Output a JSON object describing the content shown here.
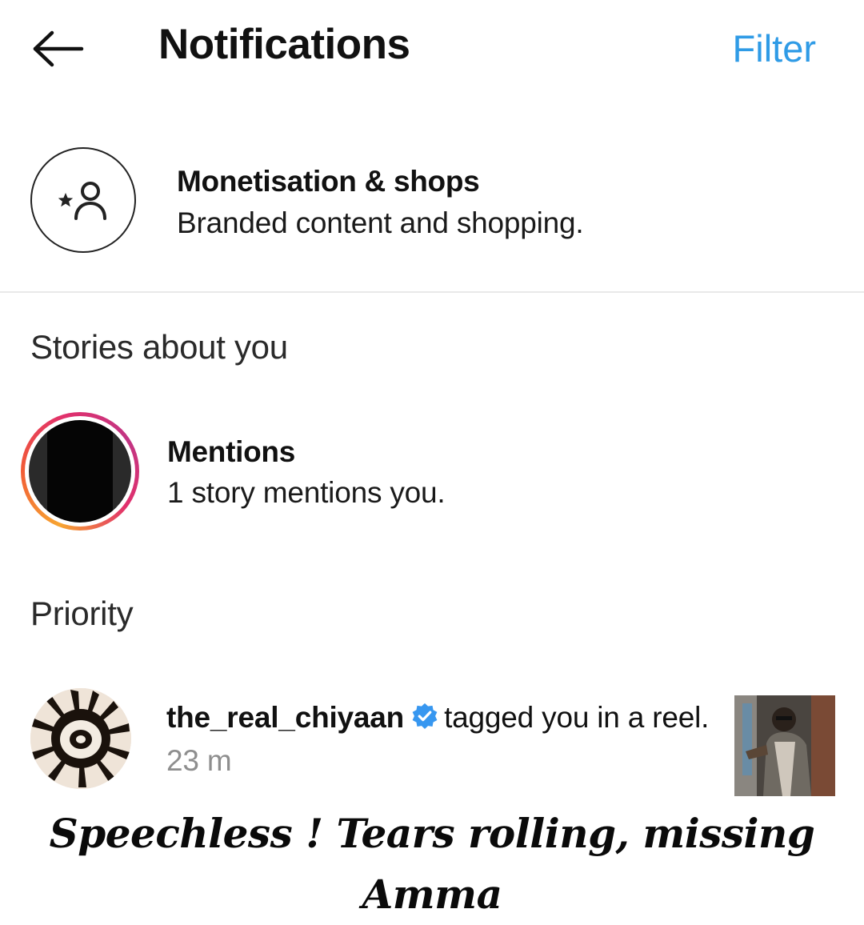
{
  "header": {
    "back_icon": "arrow-left-icon",
    "title": "Notifications",
    "filter_label": "Filter",
    "accent_color": "#2f9be6"
  },
  "monetisation": {
    "icon": "person-star-icon",
    "title": "Monetisation & shops",
    "subtitle": "Branded content and shopping."
  },
  "stories_section": {
    "header": "Stories about you",
    "mentions": {
      "title": "Mentions",
      "subtitle": "1 story mentions you."
    }
  },
  "priority_section": {
    "header": "Priority",
    "notification": {
      "username": "the_real_chiyaan",
      "verified_icon": "verified-badge-icon",
      "action_text": "tagged you in a reel.",
      "timestamp": "23 m"
    }
  },
  "caption": "Speechless ! Tears rolling, missing Amma"
}
